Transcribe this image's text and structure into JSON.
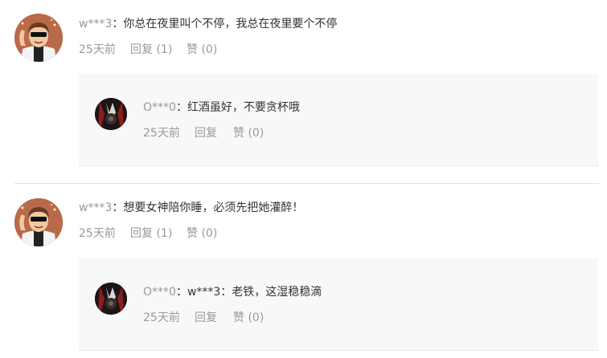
{
  "comments": [
    {
      "user": "w***3",
      "separator": "：",
      "content": "你总在夜里叫个不停，我总在夜里要个不停",
      "time": "25天前",
      "reply_label": "回复 (1)",
      "like_label": "赞 (0)",
      "reply": {
        "user": "O***0",
        "separator": "：",
        "content": "红酒虽好，不要贪杯哦",
        "time": "25天前",
        "reply_label": "回复",
        "like_label": "赞 (0)"
      }
    },
    {
      "user": "w***3",
      "separator": "：",
      "content": "想要女神陪你睡，必须先把她灌醉！",
      "time": "25天前",
      "reply_label": "回复 (1)",
      "like_label": "赞 (0)",
      "reply": {
        "user": "O***0",
        "separator": "：",
        "content": "w***3：老铁，这湿稳稳滴",
        "time": "25天前",
        "reply_label": "回复",
        "like_label": "赞 (0)"
      }
    }
  ],
  "icons": {
    "avatar_main": "cartoon-man-sunglasses-avatar",
    "avatar_reply": "dark-photo-avatar"
  },
  "colors": {
    "muted_text": "#999999",
    "body_text": "#333333",
    "reply_bg": "#f7f8fa",
    "divider": "#e5e5e5"
  }
}
